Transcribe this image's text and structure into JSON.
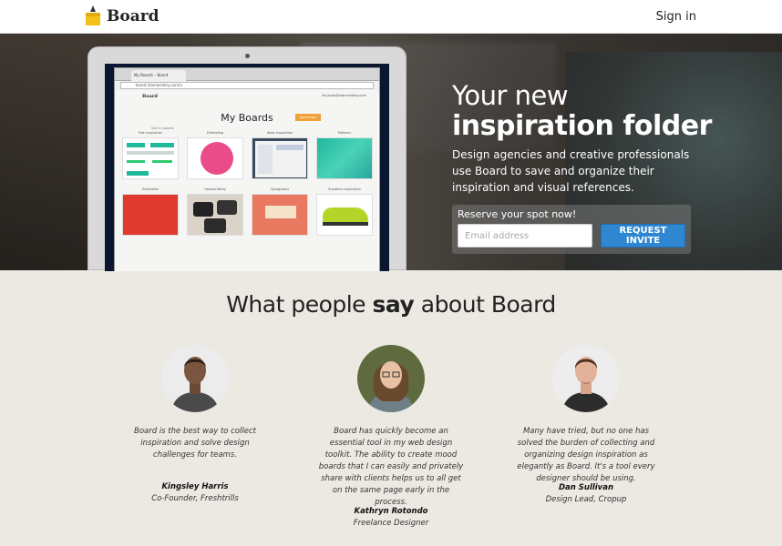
{
  "header": {
    "brand": "Board",
    "signin_label": "Sign in"
  },
  "hero": {
    "title_line1": "Your new",
    "title_line2": "inspiration folder",
    "description": "Design agencies and creative professionals use Board to save and organize their inspiration and visual references.",
    "signup_label": "Reserve your spot now!",
    "email_placeholder": "Email address",
    "invite_label": "REQUEST INVITE",
    "accent_color": "#2f87d1"
  },
  "preview": {
    "tab_label": "My Boards – Board",
    "url": "board.stamasidesy.com/u",
    "brand": "Board",
    "user": "fat.jacob@stamasidesy.com",
    "page_title": "My Boards",
    "new_button": "NEW BOARD",
    "sort_label": "Sort in boards",
    "tiles": [
      {
        "label": "Flat inspiration"
      },
      {
        "label": "Dribbbling"
      },
      {
        "label": "Xbox inspiration"
      },
      {
        "label": "Patterns"
      },
      {
        "label": "Illustration"
      },
      {
        "label": "Handwrittedy"
      },
      {
        "label": "Typography"
      },
      {
        "label": "Sneakers inspiration"
      }
    ]
  },
  "testimonials": {
    "heading_pre": "What people ",
    "heading_bold": "say",
    "heading_post": " about Board",
    "items": [
      {
        "quote": "Board is the best way to collect inspiration and solve design challenges for teams.",
        "name": "Kingsley Harris",
        "role": "Co-Founder, Freshtrills"
      },
      {
        "quote": "Board has quickly become an essential tool in my web design toolkit. The ability to create mood boards that I can easily and privately share with clients helps us to all get on the same page early in the process.",
        "name": "Kathryn Rotondo",
        "role": "Freelance Designer"
      },
      {
        "quote": "Many have tried, but no one has solved the burden of collecting and organizing design inspiration as elegantly as Board. It's a tool every designer should be using.",
        "name": "Dan Sullivan",
        "role": "Design Lead, Cropup"
      }
    ]
  }
}
